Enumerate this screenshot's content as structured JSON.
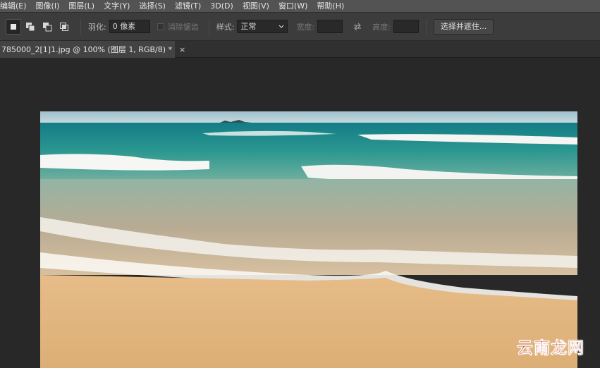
{
  "menubar": {
    "items": [
      "编辑(E)",
      "图像(I)",
      "图层(L)",
      "文字(Y)",
      "选择(S)",
      "滤镜(T)",
      "3D(D)",
      "视图(V)",
      "窗口(W)",
      "帮助(H)"
    ]
  },
  "options": {
    "feather_label": "羽化:",
    "feather_value": "0 像素",
    "antialias_label": "消除锯齿",
    "style_label": "样式:",
    "style_value": "正常",
    "width_label": "宽度:",
    "height_label": "高度:",
    "select_mask_button": "选择并遮住..."
  },
  "tab": {
    "title": "785000_2[1]1.jpg @ 100% (图层 1, RGB/8) *",
    "close": "×"
  },
  "watermark": {
    "text": "云南龙网"
  },
  "colors": {
    "sky": "#a8c6cf",
    "sea_deep": "#1c8a87",
    "sea_mid": "#4aa39a",
    "foam": "#f4f4f0",
    "wet_sand": "#c9b59a",
    "sand": "#e0b47d",
    "watermark": "#c41c1c"
  }
}
